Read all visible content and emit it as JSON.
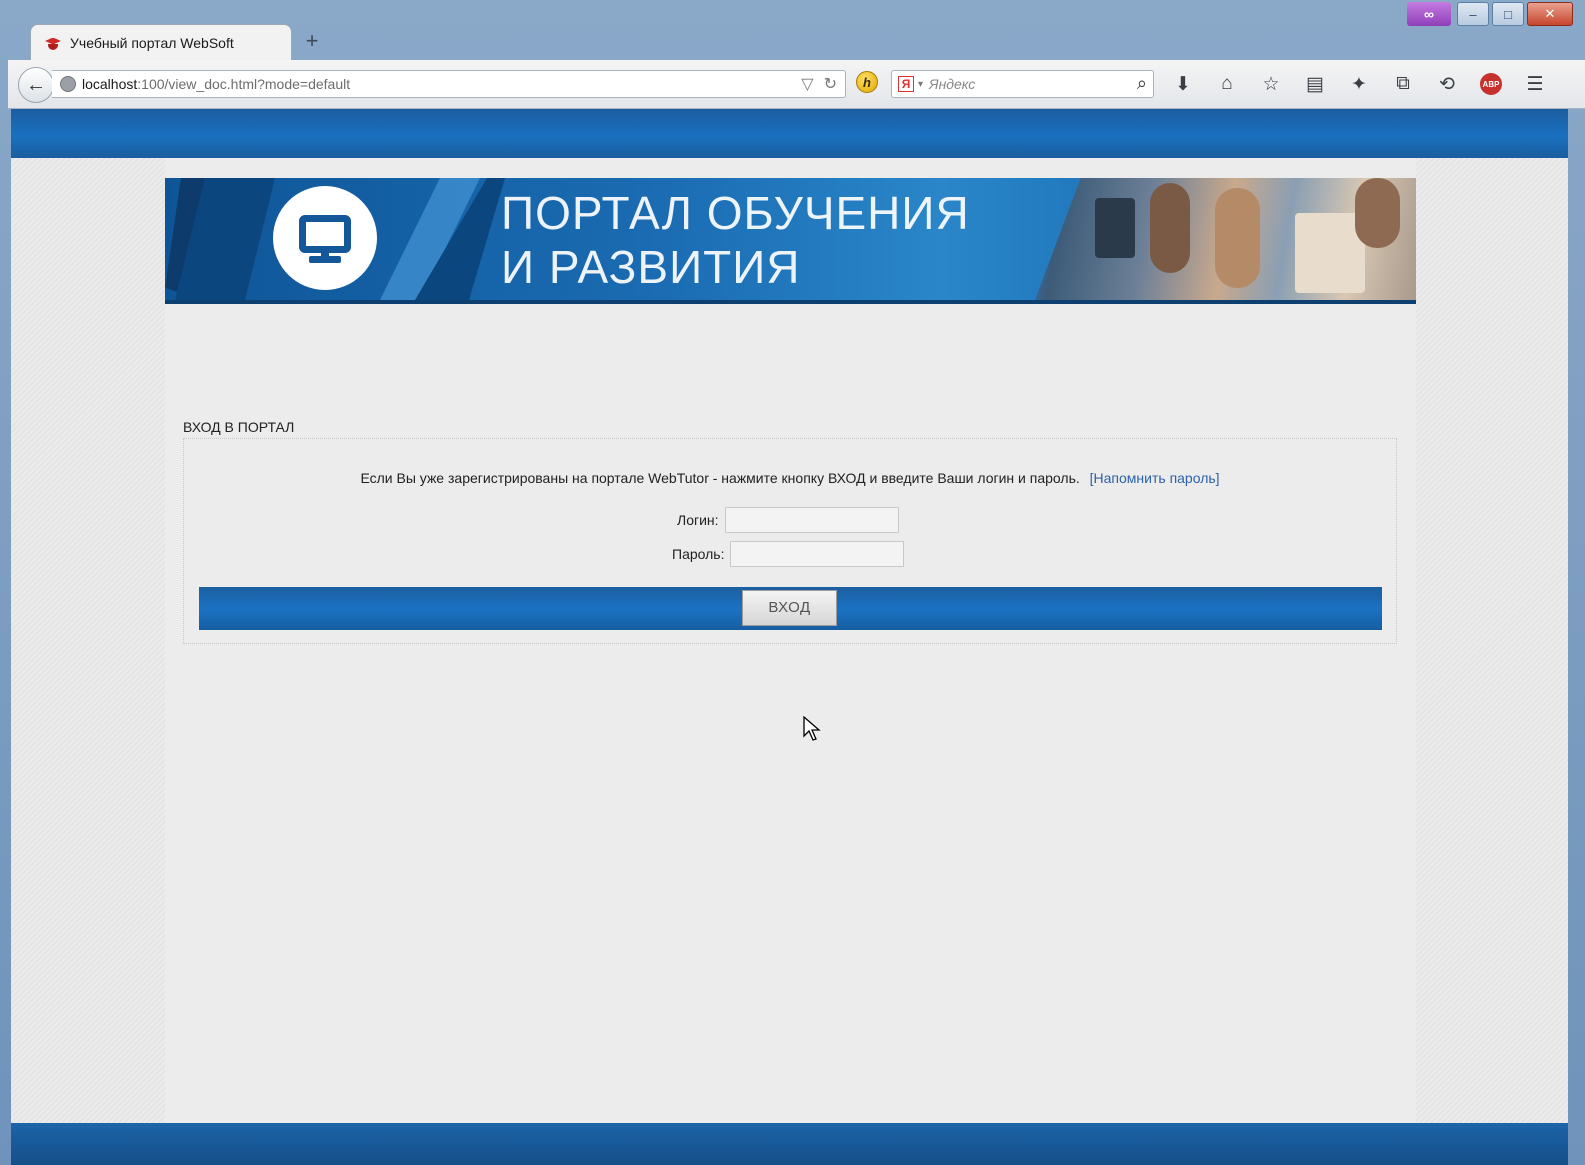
{
  "browser": {
    "tab_title": "Учебный портал WebSoft",
    "new_tab": "+",
    "url_host": "localhost",
    "url_path": ":100/view_doc.html?mode=default",
    "search_placeholder": "Яндекс",
    "search_engine_icon": "Я",
    "addon_h": "h",
    "abp_label": "ABP",
    "window_controls": [
      "–",
      "□",
      "✕"
    ]
  },
  "banner": {
    "title_line1": "ПОРТАЛ ОБУЧЕНИЯ",
    "title_line2": "И РАЗВИТИЯ"
  },
  "login": {
    "section_title": "ВХОД В ПОРТАЛ",
    "message": "Если Вы уже зарегистрированы на портале WebTutor - нажмите кнопку ВХОД и введите Ваши логин и пароль.",
    "remind_link": "[Напомнить пароль]",
    "login_label": "Логин:",
    "password_label": "Пароль:",
    "login_value": "",
    "password_value": "",
    "submit_label": "ВХОД"
  },
  "colors": {
    "brand_blue": "#1a6bb5",
    "link": "#2c62a8"
  }
}
